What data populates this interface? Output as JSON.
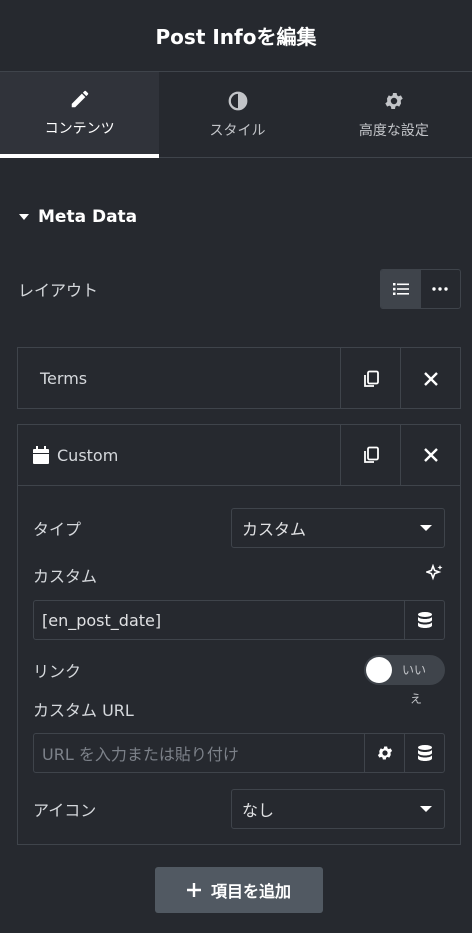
{
  "panel": {
    "title": "Post Infoを編集"
  },
  "tabs": [
    {
      "label": "コンテンツ",
      "icon": "pencil-icon"
    },
    {
      "label": "スタイル",
      "icon": "contrast-icon"
    },
    {
      "label": "高度な設定",
      "icon": "gear-icon"
    }
  ],
  "section": {
    "title": "Meta Data"
  },
  "layout": {
    "label": "レイアウト"
  },
  "items": [
    {
      "title": "Terms"
    },
    {
      "title": "Custom",
      "icon": "calendar-icon"
    }
  ],
  "custom": {
    "type_label": "タイプ",
    "type_value": "カスタム",
    "custom_label": "カスタム",
    "custom_value": "[en_post_date]",
    "link_label": "リンク",
    "toggle_text": "いい",
    "toggle_text2": "え",
    "url_label": "カスタム URL",
    "url_placeholder": "URL を入力または貼り付け",
    "icon_label": "アイコン",
    "icon_value": "なし"
  },
  "add_button": {
    "label": "項目を追加"
  }
}
